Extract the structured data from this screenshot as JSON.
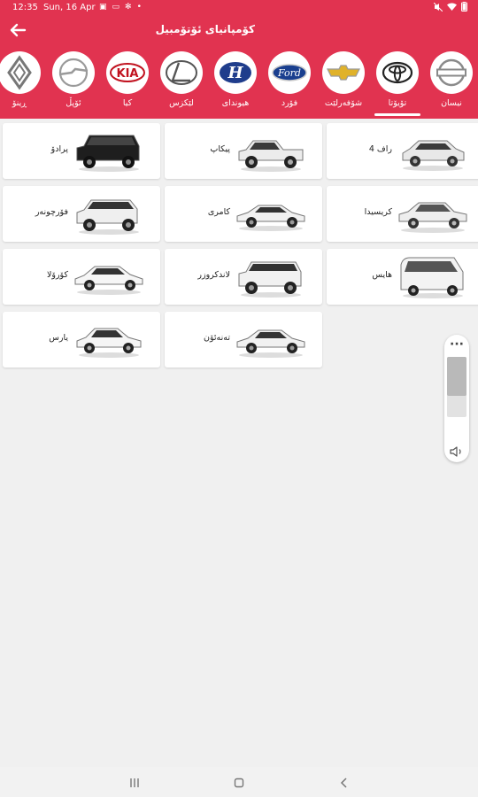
{
  "status": {
    "time": "12:35",
    "date": "Sun, 16 Apr"
  },
  "appbar": {
    "title": "کۆمپانیای ئۆتۆمبیل"
  },
  "colors": {
    "accent": "#e13350"
  },
  "brands": [
    {
      "label": "نیسان",
      "logo": "nissan-logo"
    },
    {
      "label": "تۆیۆتا",
      "logo": "toyota-logo",
      "selected": true
    },
    {
      "label": "شۆفەرلێت",
      "logo": "chevrolet-logo"
    },
    {
      "label": "فۆرد",
      "logo": "ford-logo"
    },
    {
      "label": "هیوندای",
      "logo": "hyundai-logo"
    },
    {
      "label": "لێکزس",
      "logo": "lexus-logo"
    },
    {
      "label": "کیا",
      "logo": "kia-logo"
    },
    {
      "label": "ئۆپڵ",
      "logo": "opel-logo"
    },
    {
      "label": "ڕینۆ",
      "logo": "renault-logo"
    }
  ],
  "models": [
    {
      "label": "راف 4",
      "color": "#e9e9e9"
    },
    {
      "label": "پیکاپ",
      "color": "#ececec"
    },
    {
      "label": "پرادۆ",
      "color": "#1e1e1e"
    },
    {
      "label": "کریسیدا",
      "color": "#eeeeee"
    },
    {
      "label": "کامری",
      "color": "#f1f1f1"
    },
    {
      "label": "فۆرچونەر",
      "color": "#efefef"
    },
    {
      "label": "هایس",
      "color": "#f3f3f3"
    },
    {
      "label": "لاندکروزر",
      "color": "#f1f1f1"
    },
    {
      "label": "کۆرۆلا",
      "color": "#f6f6f6"
    },
    {
      "label": "تەنەئۆن",
      "color": "#f1f1f1"
    },
    {
      "label": "یارس",
      "color": "#f5f5f5"
    }
  ]
}
